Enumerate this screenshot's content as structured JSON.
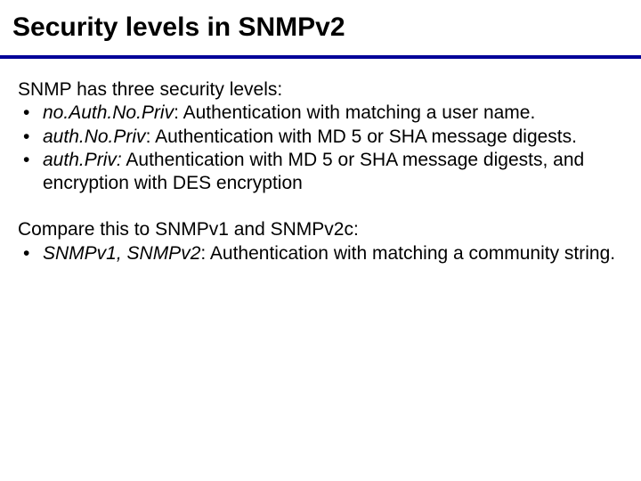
{
  "colors": {
    "accent": "#000099"
  },
  "title": "Security levels in SNMPv2",
  "section1": {
    "intro": "SNMP has three security levels:",
    "items": [
      {
        "term": "no.Auth.No.Priv",
        "sep": ": ",
        "desc": "Authentication with matching a user name."
      },
      {
        "term": "auth.No.Priv",
        "sep": ": ",
        "desc": "Authentication with MD 5 or SHA message digests."
      },
      {
        "term": " auth.Priv:",
        "sep": " ",
        "desc": "Authentication with MD 5 or SHA message digests, and encryption with DES encryption"
      }
    ]
  },
  "section2": {
    "intro": "Compare this to SNMPv1 and SNMPv2c:",
    "items": [
      {
        "term": "SNMPv1, SNMPv2",
        "sep": ": ",
        "desc": "Authentication with matching a community string."
      }
    ]
  }
}
